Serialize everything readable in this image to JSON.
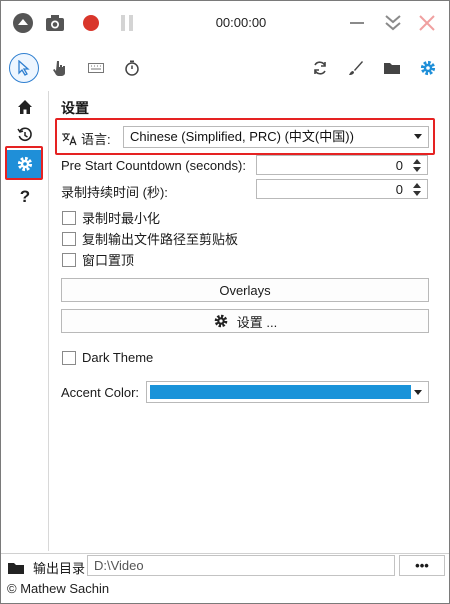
{
  "titlebar": {
    "timer": "00:00:00",
    "icons": [
      "menu-up-icon",
      "camera-icon",
      "record-icon",
      "pause-icon",
      "minimize-icon",
      "collapse-icon",
      "close-icon"
    ]
  },
  "toolbar": {
    "tools": [
      "pointer-icon",
      "hand-icon",
      "keyboard-icon",
      "stopwatch-icon"
    ],
    "right_tools": [
      "refresh-icon",
      "brush-icon",
      "folder-icon",
      "gear-icon"
    ]
  },
  "nav": {
    "items": [
      "home-icon",
      "history-icon",
      "gear-icon",
      "help-icon"
    ],
    "active_index": 2
  },
  "settings": {
    "title": "设置",
    "language_label": "语言:",
    "language_value": "Chinese (Simplified, PRC) (中文(中国))",
    "countdown_label": "Pre Start Countdown (seconds):",
    "countdown_value": "0",
    "duration_label": "录制持续时间 (秒):",
    "duration_value": "0",
    "checks": [
      {
        "label": "录制时最小化",
        "checked": false
      },
      {
        "label": "复制输出文件路径至剪贴板",
        "checked": false
      },
      {
        "label": "窗口置顶",
        "checked": false
      }
    ],
    "overlays_button": "Overlays",
    "settings_button": "设置 ...",
    "dark_theme_label": "Dark Theme",
    "accent_label": "Accent Color:",
    "accent_color": "#1a93d9"
  },
  "output": {
    "label": "输出目录",
    "path": "D:\\Video",
    "more_button": "•••"
  },
  "footer": {
    "copyright": "© Mathew Sachin"
  },
  "colors": {
    "accent": "#1f8fd8",
    "highlight_box": "#e52222",
    "record": "#d9362b"
  }
}
